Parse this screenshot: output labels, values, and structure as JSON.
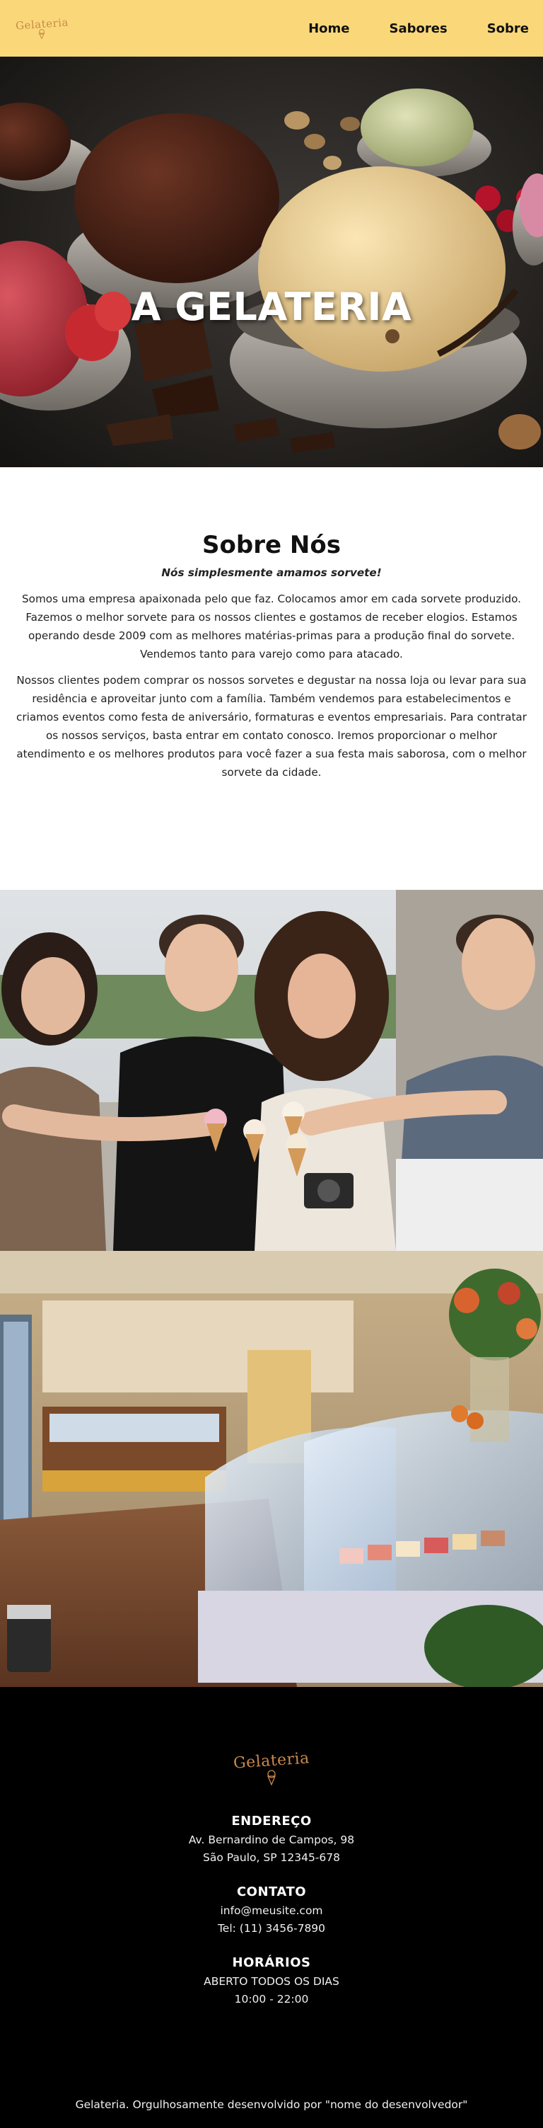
{
  "header": {
    "logo_text": "Gelateria",
    "nav": [
      "Home",
      "Sabores",
      "Sobre"
    ]
  },
  "hero": {
    "title": "A GELATERIA"
  },
  "about": {
    "title": "Sobre Nós",
    "subtitle": "Nós simplesmente amamos sorvete!",
    "paragraphs": [
      "Somos uma empresa apaixonada pelo que faz. Colocamos amor em cada sorvete produzido. Fazemos o melhor sorvete para os nossos clientes e gostamos de receber elogios. Estamos operando desde 2009 com as melhores matérias-primas para a produção final do sorvete. Vendemos tanto para varejo como para atacado.",
      "Nossos clientes podem comprar os nossos sorvetes e degustar na nossa loja ou levar para sua residência e aproveitar junto com a família. Também vendemos para estabelecimentos e criamos eventos como festa de aniversário, formaturas e eventos empresariais. Para contratar os nossos serviços, basta entrar em contato conosco. Iremos proporcionar o melhor atendimento e os melhores produtos para você fazer a sua festa mais saborosa, com o melhor sorvete da cidade."
    ]
  },
  "footer": {
    "logo_text": "Gelateria",
    "address": {
      "heading": "ENDEREÇO",
      "lines": [
        "Av. Bernardino de Campos, 98",
        "São Paulo, SP 12345-678"
      ]
    },
    "contact": {
      "heading": "CONTATO",
      "lines": [
        "info@meusite.com",
        "Tel: (11) 3456-7890"
      ]
    },
    "hours": {
      "heading": "HORÁRIOS",
      "lines": [
        "ABERTO TODOS OS DIAS",
        "10:00 - 22:00"
      ]
    },
    "credit": "Gelateria. Orgulhosamente desenvolvido por \"nome do desenvolvedor\""
  },
  "colors": {
    "header_bg": "#fad87a",
    "logo": "#c98a49",
    "footer_bg": "#000000"
  },
  "icons": {
    "logo_mark": "ice-cream-cone-icon"
  }
}
